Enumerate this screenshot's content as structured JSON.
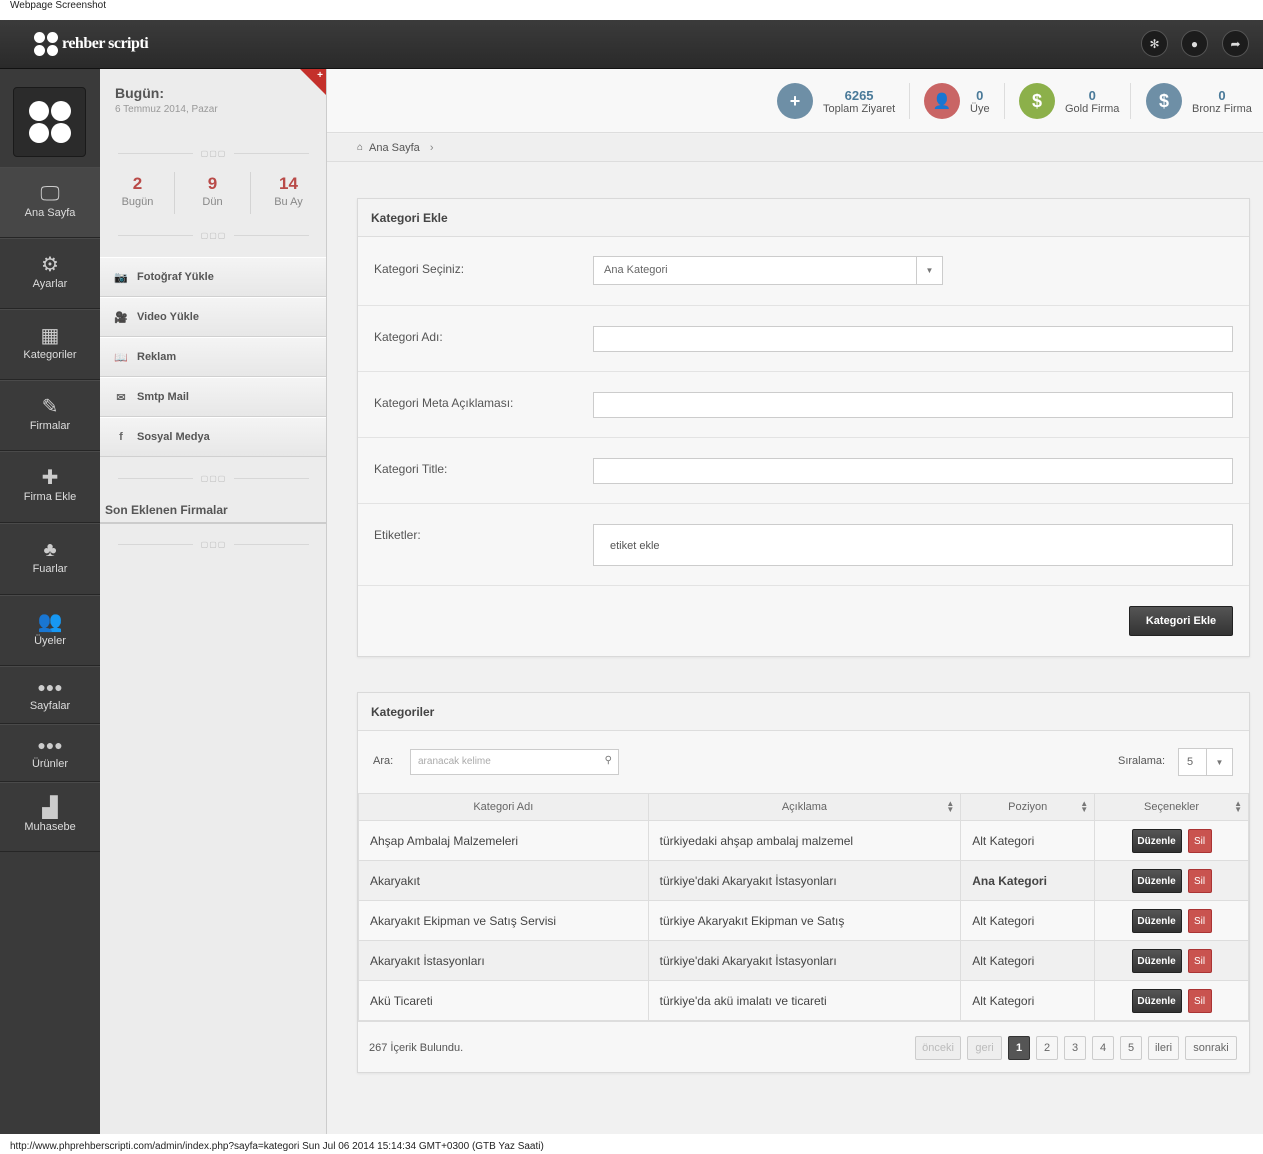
{
  "caption": "Webpage Screenshot",
  "footer_url": "http://www.phprehberscripti.com/admin/index.php?sayfa=kategori Sun Jul 06 2014 15:14:34 GMT+0300 (GTB Yaz Saati)",
  "topbar": {
    "logo_text": "rehber scripti"
  },
  "leftnav": {
    "items": [
      {
        "label": "Ana Sayfa",
        "icon": "monitor-icon"
      },
      {
        "label": "Ayarlar",
        "icon": "gear-icon"
      },
      {
        "label": "Kategoriler",
        "icon": "layout-icon"
      },
      {
        "label": "Firmalar",
        "icon": "edit-icon"
      },
      {
        "label": "Firma Ekle",
        "icon": "plus-icon"
      },
      {
        "label": "Fuarlar",
        "icon": "tree-icon"
      },
      {
        "label": "Üyeler",
        "icon": "users-icon"
      },
      {
        "label": "Sayfalar",
        "icon": "dots-icon"
      },
      {
        "label": "Ürünler",
        "icon": "dots-icon"
      },
      {
        "label": "Muhasebe",
        "icon": "bar-chart-icon"
      }
    ]
  },
  "subpanel": {
    "today_title": "Bugün:",
    "today_date": "6 Temmuz 2014, Pazar",
    "stats": [
      {
        "value": "2",
        "label": "Bugün"
      },
      {
        "value": "9",
        "label": "Dün"
      },
      {
        "value": "14",
        "label": "Bu Ay"
      }
    ],
    "links": [
      "Fotoğraf Yükle",
      "Video Yükle",
      "Reklam",
      "Smtp Mail",
      "Sosyal Medya"
    ],
    "recent_title": "Son Eklenen Firmalar"
  },
  "topstats": [
    {
      "value": "6265",
      "label": "Toplam Ziyaret",
      "color": "#6e8fa6",
      "icon": "+"
    },
    {
      "value": "0",
      "label": "Üye",
      "color": "#c96565",
      "icon": "user"
    },
    {
      "value": "0",
      "label": "Gold Firma",
      "color": "#8cb04a",
      "icon": "$"
    },
    {
      "value": "0",
      "label": "Bronz Firma",
      "color": "#6e8fa6",
      "icon": "$"
    }
  ],
  "breadcrumb": {
    "home": "Ana Sayfa"
  },
  "form": {
    "title": "Kategori Ekle",
    "select_label": "Kategori Seçiniz:",
    "select_value": "Ana Kategori",
    "name_label": "Kategori Adı:",
    "meta_label": "Kategori Meta Açıklaması:",
    "title_label": "Kategori Title:",
    "tags_label": "Etiketler:",
    "tags_placeholder": "etiket ekle",
    "submit": "Kategori Ekle"
  },
  "list": {
    "title": "Kategoriler",
    "search_label": "Ara:",
    "search_placeholder": "aranacak kelime",
    "sort_label": "Sıralama:",
    "sort_value": "5",
    "columns": [
      "Kategori Adı",
      "Açıklama",
      "Poziyon",
      "Seçenekler"
    ],
    "rows": [
      {
        "name": "Ahşap Ambalaj Malzemeleri",
        "desc": "türkiyedaki ahşap ambalaj malzemel",
        "pos": "Alt Kategori",
        "bold": false
      },
      {
        "name": "Akaryakıt",
        "desc": "türkiye'daki Akaryakıt İstasyonları",
        "pos": "Ana Kategori",
        "bold": true
      },
      {
        "name": "Akaryakıt Ekipman ve Satış Servisi",
        "desc": "türkiye Akaryakıt Ekipman ve Satış",
        "pos": "Alt Kategori",
        "bold": false
      },
      {
        "name": "Akaryakıt İstasyonları",
        "desc": "türkiye'daki Akaryakıt İstasyonları",
        "pos": "Alt Kategori",
        "bold": false
      },
      {
        "name": "Akü Ticareti",
        "desc": "türkiye'da akü imalatı ve ticareti",
        "pos": "Alt Kategori",
        "bold": false
      }
    ],
    "edit_label": "Düzenle",
    "delete_label": "Sil",
    "found": "267 İçerik Bulundu.",
    "pager": {
      "first": "önceki",
      "prev": "geri",
      "pages": [
        "1",
        "2",
        "3",
        "4",
        "5"
      ],
      "current": "1",
      "next": "ileri",
      "last": "sonraki"
    }
  }
}
